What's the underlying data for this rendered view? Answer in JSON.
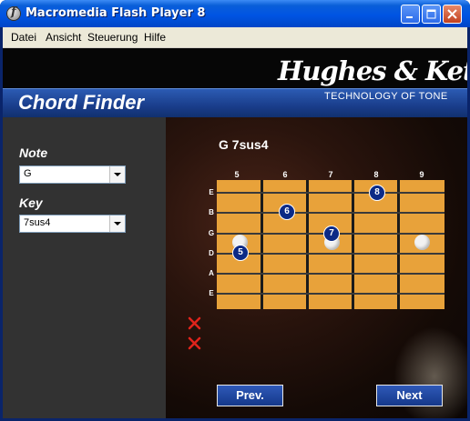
{
  "window": {
    "title": "Macromedia Flash Player 8"
  },
  "menu": [
    "Datei",
    "Ansicht",
    "Steuerung",
    "Hilfe"
  ],
  "logo": {
    "brand": "Hughes & Kettner",
    "tagline": "TECHNOLOGY OF TONE"
  },
  "app": {
    "title": "Chord Finder"
  },
  "form": {
    "note": {
      "label": "Note",
      "value": "G"
    },
    "key": {
      "label": "Key",
      "value": "7sus4"
    }
  },
  "result": {
    "chord": "G 7sus4"
  },
  "fretboard": {
    "frets": [
      "5",
      "6",
      "7",
      "8",
      "9"
    ],
    "strings": [
      "E",
      "B",
      "G",
      "D",
      "A",
      "E"
    ],
    "muted_strings": [
      "A",
      "E"
    ],
    "finger_labels": [
      "6",
      "8",
      "7",
      "5"
    ]
  },
  "buttons": {
    "prev": "Prev.",
    "next": "Next"
  }
}
